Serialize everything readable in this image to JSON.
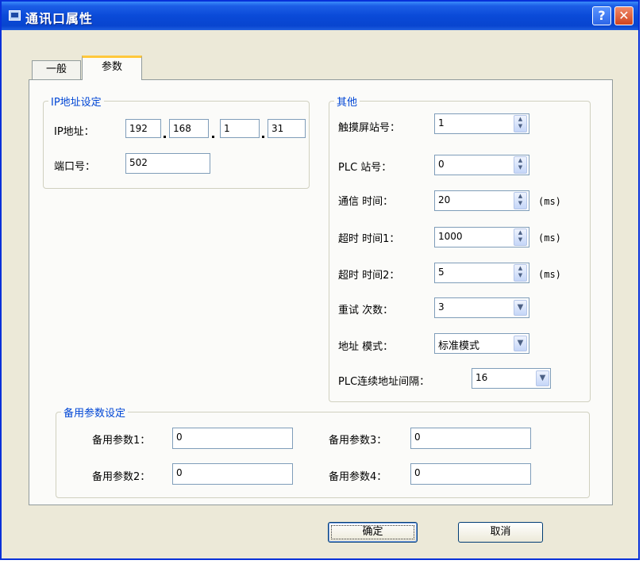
{
  "window": {
    "title": "通讯口属性",
    "help_glyph": "?",
    "close_glyph": "✕"
  },
  "tabs": [
    {
      "label": "一般"
    },
    {
      "label": "参数"
    }
  ],
  "ip_group": {
    "title": "IP地址设定",
    "ip_label": "IP地址：",
    "ip_octets": [
      "192",
      "168",
      "1",
      "31"
    ],
    "port_label": "端口号：",
    "port_value": "502"
  },
  "other_group": {
    "title": "其他",
    "rows": [
      {
        "label": "触摸屏站号：",
        "value": "1"
      },
      {
        "label": "PLC  站号：",
        "value": "0"
      },
      {
        "label": "通信  时间：",
        "value": "20",
        "unit": "(ms)"
      },
      {
        "label": "超时  时间1：",
        "value": "1000",
        "unit": "(ms)"
      },
      {
        "label": "超时  时间2：",
        "value": "5",
        "unit": "(ms)"
      },
      {
        "label": "重试  次数：",
        "value": "3"
      },
      {
        "label": "地址  模式：",
        "value": "标准模式"
      },
      {
        "label": "PLC连续地址间隔：",
        "value": "16"
      }
    ]
  },
  "backup_group": {
    "title": "备用参数设定",
    "params": [
      {
        "label": "备用参数1：",
        "value": "0"
      },
      {
        "label": "备用参数2：",
        "value": "0"
      },
      {
        "label": "备用参数3：",
        "value": "0"
      },
      {
        "label": "备用参数4：",
        "value": "0"
      }
    ]
  },
  "buttons": {
    "ok": "确定",
    "cancel": "取消"
  },
  "colors": {
    "titlebar": "#0a4ad8",
    "group_title": "#0046d5",
    "dialog_bg": "#ece9d8",
    "tab_highlight": "#ffc83c"
  }
}
